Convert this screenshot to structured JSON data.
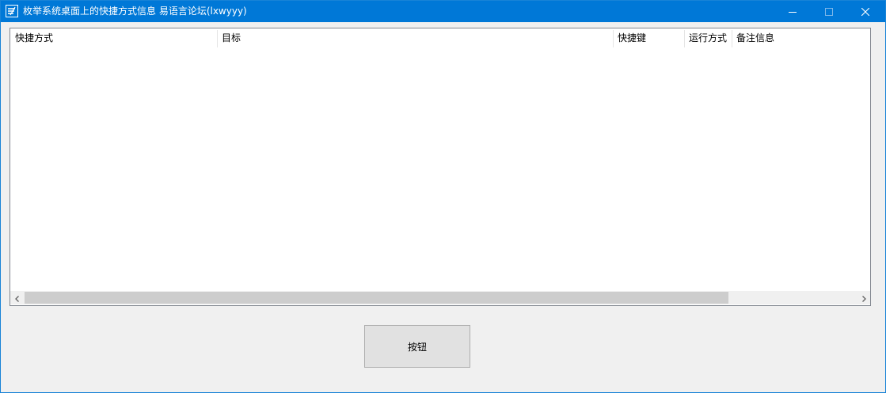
{
  "window": {
    "title": "枚举系统桌面上的快捷方式信息 易语言论坛(lxwyyy)",
    "titlebar_color": "#0078d7",
    "controls": {
      "minimize": "minimize-icon",
      "maximize": "maximize-icon",
      "close": "close-icon"
    }
  },
  "listview": {
    "columns": [
      "快捷方式",
      "目标",
      "快捷键",
      "运行方式",
      "备注信息"
    ],
    "rows": [],
    "scrollbar": {
      "left_arrow": "chevron-left-icon",
      "right_arrow": "chevron-right-icon"
    }
  },
  "button": {
    "label": "按钮"
  }
}
